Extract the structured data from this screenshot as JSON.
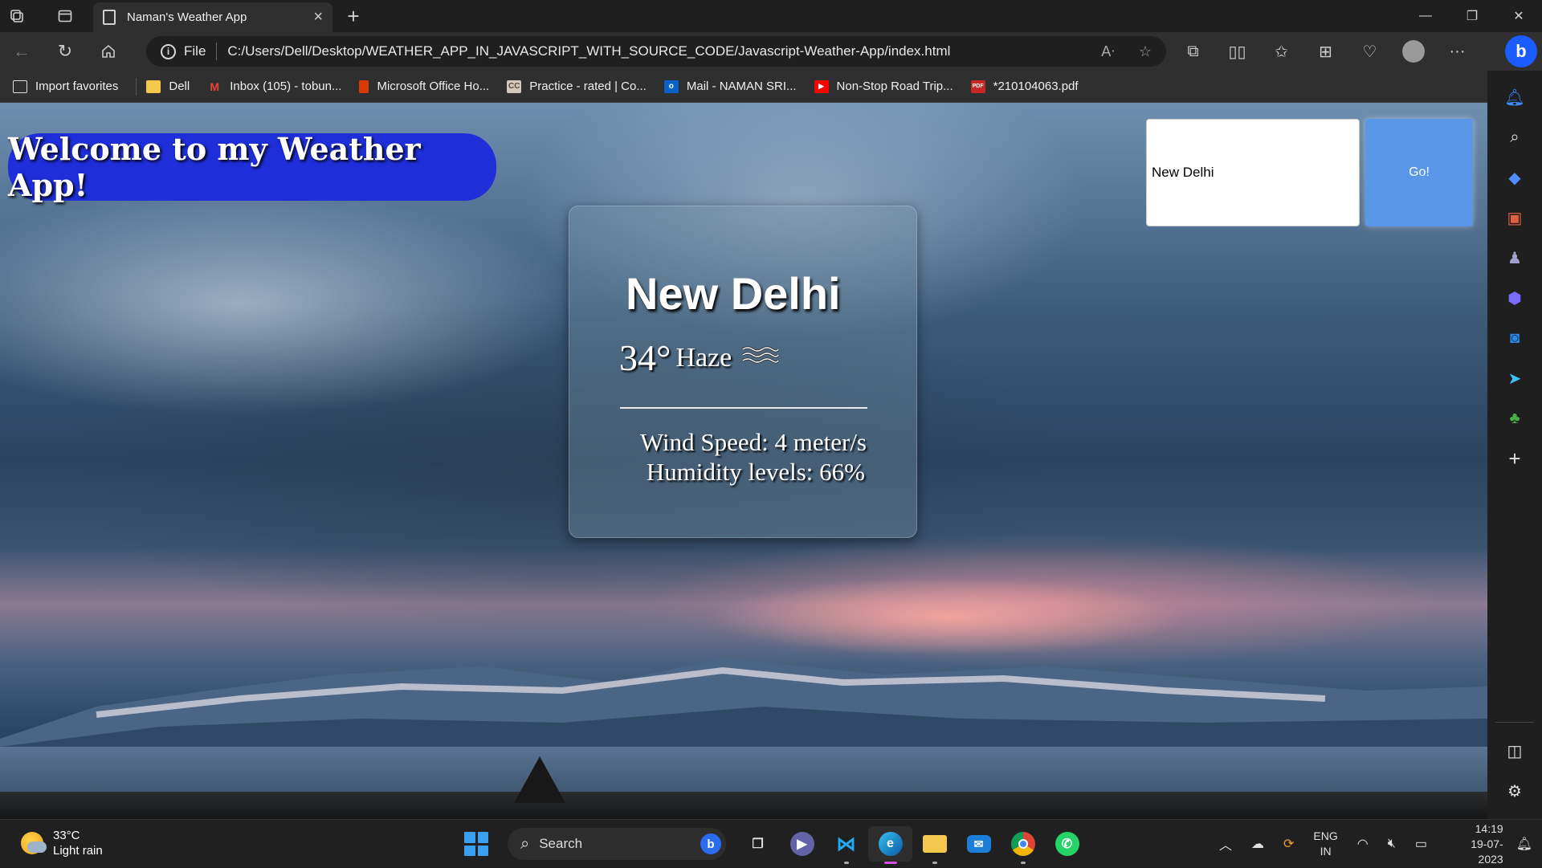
{
  "browser": {
    "tab_title": "Naman's Weather App",
    "address_scheme": "File",
    "url": "C:/Users/Dell/Desktop/WEATHER_APP_IN_JAVASCRIPT_WITH_SOURCE_CODE/Javascript-Weather-App/index.html",
    "favorites": [
      {
        "label": "Import favorites",
        "icon": "import-icon"
      },
      {
        "label": "Dell",
        "icon": "folder-icon"
      },
      {
        "label": "Inbox (105) - tobun...",
        "icon": "gmail-icon"
      },
      {
        "label": "Microsoft Office Ho...",
        "icon": "office-icon"
      },
      {
        "label": "Practice - rated | Co...",
        "icon": "codechef-icon"
      },
      {
        "label": "Mail - NAMAN SRI...",
        "icon": "outlook-icon"
      },
      {
        "label": "Non-Stop Road Trip...",
        "icon": "youtube-icon"
      },
      {
        "label": "*210104063.pdf",
        "icon": "pdf-icon"
      }
    ],
    "accent_color": "#1a5cff"
  },
  "app": {
    "welcome_text": "Welcome to my Weather App!",
    "search_value": "New Delhi",
    "go_label": "Go!",
    "colors": {
      "welcome_bg": "#1e2ed8",
      "go_bg": "#5a97e8"
    }
  },
  "weather": {
    "city": "New Delhi",
    "temperature": "34°",
    "description": "Haze",
    "description_icon": "haze-icon",
    "wind_speed": "Wind Speed: 4 meter/s",
    "humidity": "Humidity levels: 66%"
  },
  "taskbar": {
    "weather_temp": "33°C",
    "weather_desc": "Light rain",
    "search_label": "Search",
    "lang_top": "ENG",
    "lang_bottom": "IN",
    "time": "14:19",
    "date": "19-07-2023"
  }
}
